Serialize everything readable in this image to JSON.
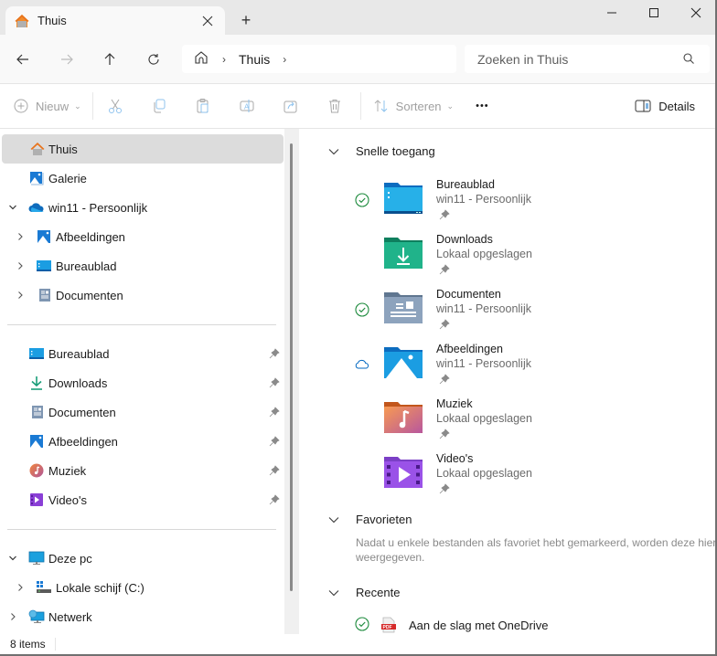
{
  "window": {
    "tab_title": "Thuis",
    "tab_icon": "home-icon",
    "new_tab_label": "+",
    "controls": [
      "minimize",
      "maximize",
      "close"
    ]
  },
  "nav": {
    "back": "back-arrow-icon",
    "forward": "forward-arrow-icon",
    "up": "up-arrow-icon",
    "refresh": "refresh-icon",
    "breadcrumb": [
      "Thuis"
    ],
    "search_placeholder": "Zoeken in Thuis"
  },
  "toolbar": {
    "new_label": "Nieuw",
    "sort_label": "Sorteren",
    "more_label": "•••",
    "details_label": "Details",
    "icons": [
      "cut-icon",
      "copy-icon",
      "paste-icon",
      "rename-icon",
      "share-icon",
      "delete-icon"
    ]
  },
  "sidebar": {
    "top": [
      {
        "label": "Thuis",
        "icon": "home-icon",
        "selected": true
      },
      {
        "label": "Galerie",
        "icon": "gallery-icon"
      },
      {
        "label": "win11 - Persoonlijk",
        "icon": "onedrive-cloud-icon",
        "expanded": true
      },
      {
        "label": "Afbeeldingen",
        "icon": "pictures-icon",
        "child": true
      },
      {
        "label": "Bureaublad",
        "icon": "desktop-icon",
        "child": true
      },
      {
        "label": "Documenten",
        "icon": "documents-icon",
        "child": true
      }
    ],
    "pinned": [
      {
        "label": "Bureaublad",
        "icon": "desktop-icon"
      },
      {
        "label": "Downloads",
        "icon": "downloads-icon"
      },
      {
        "label": "Documenten",
        "icon": "documents-icon"
      },
      {
        "label": "Afbeeldingen",
        "icon": "pictures-icon"
      },
      {
        "label": "Muziek",
        "icon": "music-icon"
      },
      {
        "label": "Video's",
        "icon": "videos-icon"
      }
    ],
    "bottom": [
      {
        "label": "Deze pc",
        "icon": "pc-icon",
        "expanded": true
      },
      {
        "label": "Lokale schijf (C:)",
        "icon": "drive-icon",
        "child": true
      },
      {
        "label": "Netwerk",
        "icon": "network-icon"
      }
    ]
  },
  "main": {
    "quick_access_title": "Snelle toegang",
    "quick_access": [
      {
        "name": "Bureaublad",
        "location": "win11 - Persoonlijk",
        "status": "synced",
        "icon": "desktop-folder-icon"
      },
      {
        "name": "Downloads",
        "location": "Lokaal opgeslagen",
        "status": "",
        "icon": "downloads-folder-icon"
      },
      {
        "name": "Documenten",
        "location": "win11 - Persoonlijk",
        "status": "synced",
        "icon": "documents-folder-icon"
      },
      {
        "name": "Afbeeldingen",
        "location": "win11 - Persoonlijk",
        "status": "cloud",
        "icon": "pictures-folder-icon"
      },
      {
        "name": "Muziek",
        "location": "Lokaal opgeslagen",
        "status": "",
        "icon": "music-folder-icon"
      },
      {
        "name": "Video's",
        "location": "Lokaal opgeslagen",
        "status": "",
        "icon": "videos-folder-icon"
      }
    ],
    "favorites_title": "Favorieten",
    "favorites_empty": "Nadat u enkele bestanden als favoriet hebt gemarkeerd, worden deze hier weergegeven.",
    "recent_title": "Recente",
    "recent": [
      {
        "name": "Aan de slag met OneDrive",
        "status": "synced",
        "icon": "pdf-icon",
        "badge": "PDF"
      }
    ]
  },
  "status": {
    "item_count": "8 items"
  },
  "colors": {
    "synced": "#1c8a3c",
    "cloud": "#0067c0",
    "selected_bg": "#dcdcdc"
  }
}
